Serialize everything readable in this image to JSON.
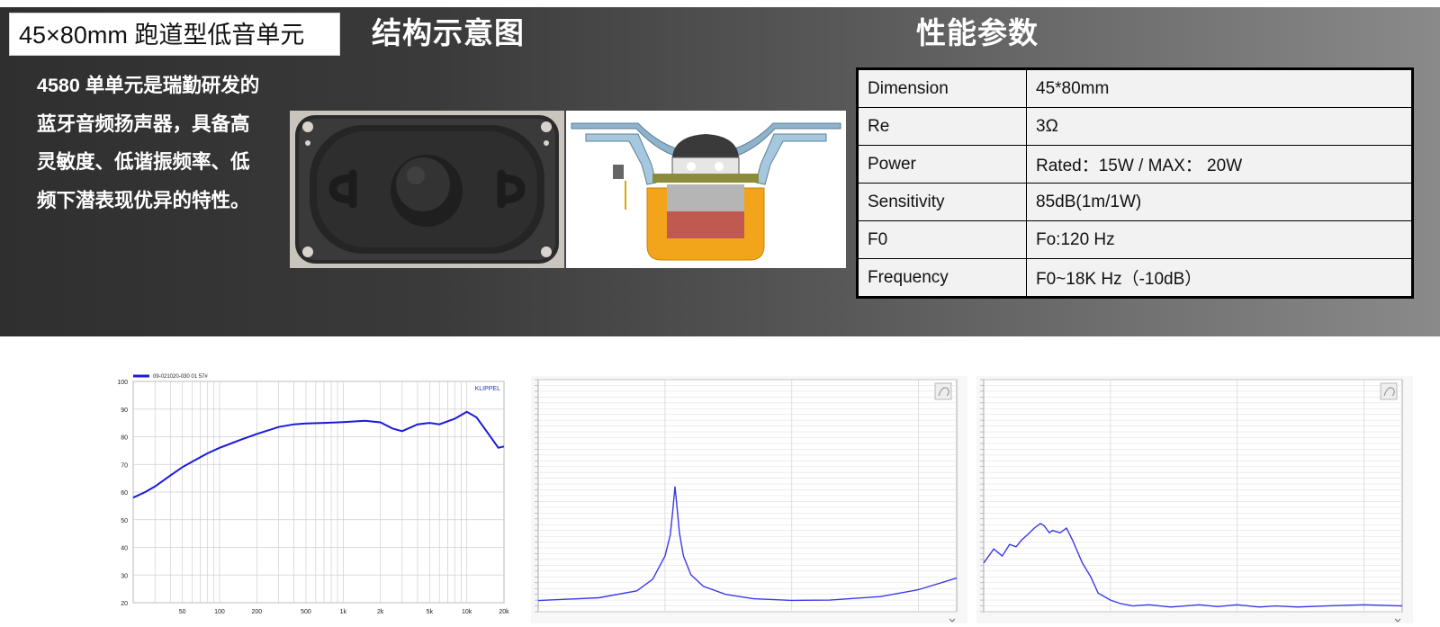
{
  "header": {
    "product_title": "45×80mm 跑道型低音单元",
    "structure_heading": "结构示意图",
    "spec_heading": "性能参数"
  },
  "description": "4580 单单元是瑞勤研发的蓝牙音频扬声器，具备高灵敏度、低谐振频率、低频下潜表现优异的特性。",
  "specs": [
    {
      "key": "Dimension",
      "value": "45*80mm"
    },
    {
      "key": "Re",
      "value": "3Ω"
    },
    {
      "key": "Power",
      "value": "Rated：15W / MAX：   20W"
    },
    {
      "key": "Sensitivity",
      "value": "85dB(1m/1W)"
    },
    {
      "key": "F0",
      "value": "Fo:120 Hz"
    },
    {
      "key": "Frequency",
      "value": "F0~18K Hz（-10dB）"
    }
  ],
  "colors": {
    "curve_blue": "#1a1adc",
    "impedance_blue": "#3a3ae8"
  },
  "chart_data": [
    {
      "type": "line",
      "legend": "09-021020-030 01 57#",
      "watermark": "KLIPPEL",
      "x_scale": "log",
      "xlim": [
        20,
        20000
      ],
      "ylim": [
        20,
        100
      ],
      "x_ticks": [
        "50",
        "100",
        "200",
        "500",
        "1k",
        "2k",
        "5k",
        "10k",
        "20k"
      ],
      "y_ticks": [
        "100",
        "90",
        "80",
        "70",
        "60",
        "50",
        "40",
        "30",
        "20"
      ],
      "series": [
        {
          "name": "09-021020-030 01 57#",
          "x": [
            20,
            25,
            30,
            40,
            50,
            60,
            80,
            100,
            150,
            200,
            300,
            400,
            500,
            700,
            1000,
            1500,
            2000,
            2500,
            3000,
            4000,
            5000,
            6000,
            8000,
            10000,
            12000,
            15000,
            18000,
            20000
          ],
          "y": [
            58,
            60,
            62,
            66,
            69,
            71,
            74,
            76,
            79,
            81,
            83.5,
            84.5,
            84.8,
            85,
            85.3,
            85.8,
            85.2,
            83,
            82,
            84.5,
            85,
            84.5,
            86.5,
            89,
            87,
            81,
            76,
            76.5
          ]
        }
      ]
    },
    {
      "type": "line",
      "x_scale": "log",
      "xlim": [
        10,
        20000
      ],
      "ylim": [
        0,
        100
      ],
      "series": [
        {
          "x": [
            10,
            30,
            60,
            80,
            100,
            110,
            115,
            120,
            125,
            130,
            140,
            160,
            200,
            300,
            500,
            1000,
            2000,
            5000,
            10000,
            20000
          ],
          "y": [
            4.8,
            6,
            9,
            14,
            24,
            33,
            43,
            54,
            44,
            34,
            24,
            16,
            11,
            7.5,
            5.6,
            4.9,
            5.0,
            6.5,
            9.5,
            14.5
          ]
        }
      ]
    },
    {
      "type": "line",
      "x_scale": "log",
      "xlim": [
        10,
        20000
      ],
      "ylim": [
        0,
        100
      ],
      "series": [
        {
          "x": [
            10,
            12,
            14,
            16,
            18,
            20,
            22,
            25,
            28,
            30,
            33,
            35,
            40,
            45,
            50,
            60,
            70,
            80,
            100,
            120,
            150,
            200,
            300,
            500,
            700,
            1000,
            1500,
            2000,
            3000,
            5000,
            10000,
            20000
          ],
          "y": [
            21,
            27,
            24,
            29,
            28,
            31,
            33,
            36,
            38,
            37,
            34,
            35,
            34,
            36,
            31,
            21,
            15,
            8,
            5,
            3.5,
            2.5,
            3,
            2,
            3,
            2.2,
            3,
            2,
            2.5,
            2,
            2.5,
            3,
            2.5
          ]
        }
      ]
    }
  ]
}
